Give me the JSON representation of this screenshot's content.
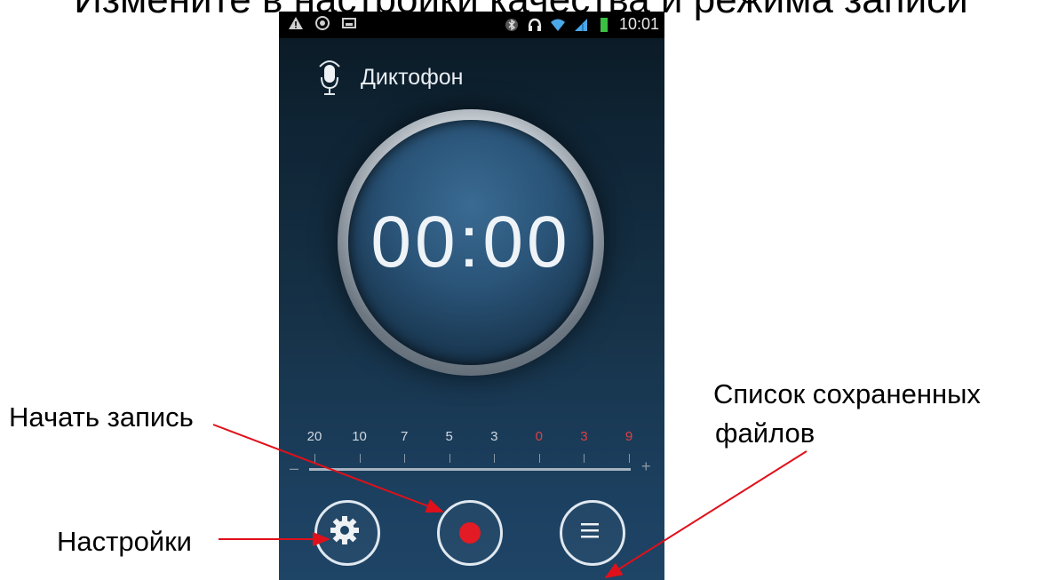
{
  "slide": {
    "title": "Измените в настройки качества и режима записи"
  },
  "status_bar": {
    "time": "10:01",
    "left_icons": [
      "warning-icon",
      "sync-icon",
      "image-icon"
    ],
    "right_icons": [
      "bluetooth-icon",
      "headset-icon",
      "wifi-icon",
      "signal-icon",
      "battery-icon"
    ]
  },
  "app": {
    "title": "Диктофон",
    "icon": "microphone-icon",
    "timer": "00:00"
  },
  "level_meter": {
    "labels": [
      {
        "text": "20",
        "color": "#d0d8e0"
      },
      {
        "text": "10",
        "color": "#d0d8e0"
      },
      {
        "text": "7",
        "color": "#d0d8e0"
      },
      {
        "text": "5",
        "color": "#d0d8e0"
      },
      {
        "text": "3",
        "color": "#d0d8e0"
      },
      {
        "text": "0",
        "color": "#e04040"
      },
      {
        "text": "3",
        "color": "#e04040"
      },
      {
        "text": "9",
        "color": "#e04040"
      }
    ],
    "minus": "–",
    "plus": "+"
  },
  "controls": {
    "settings": "gear-icon",
    "record": "record-icon",
    "list": "list-icon"
  },
  "annotations": {
    "record": "Начать запись",
    "settings": "Настройки",
    "saved_list_line1": "Список сохраненных",
    "saved_list_line2": "файлов"
  },
  "colors": {
    "accent_red": "#e21b24",
    "arrow": "#e0101a"
  }
}
